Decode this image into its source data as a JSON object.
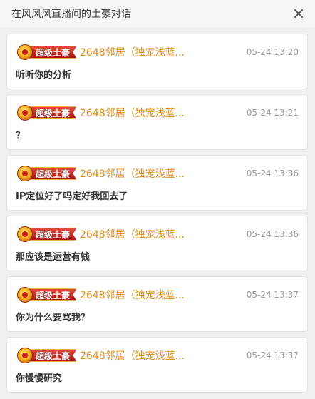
{
  "header": {
    "title": "在风风风直播间的土豪对话"
  },
  "badge_label": "超级土豪",
  "messages": [
    {
      "username": "2648邻居（独宠浅蓝...",
      "time": "05-24 13:20",
      "text": "听听你的分析"
    },
    {
      "username": "2648邻居（独宠浅蓝...",
      "time": "05-24 13:21",
      "text": "？"
    },
    {
      "username": "2648邻居（独宠浅蓝...",
      "time": "05-24 13:36",
      "text": "IP定位好了吗定好我回去了"
    },
    {
      "username": "2648邻居（独宠浅蓝...",
      "time": "05-24 13:36",
      "text": "那应该是运营有钱"
    },
    {
      "username": "2648邻居（独宠浅蓝...",
      "time": "05-24 13:37",
      "text": "你为什么要骂我？"
    },
    {
      "username": "2648邻居（独宠浅蓝...",
      "time": "05-24 13:37",
      "text": "你慢慢研究"
    }
  ],
  "colors": {
    "username": "#ec8b12",
    "timestamp": "#999999",
    "badge": "#c0201a"
  }
}
